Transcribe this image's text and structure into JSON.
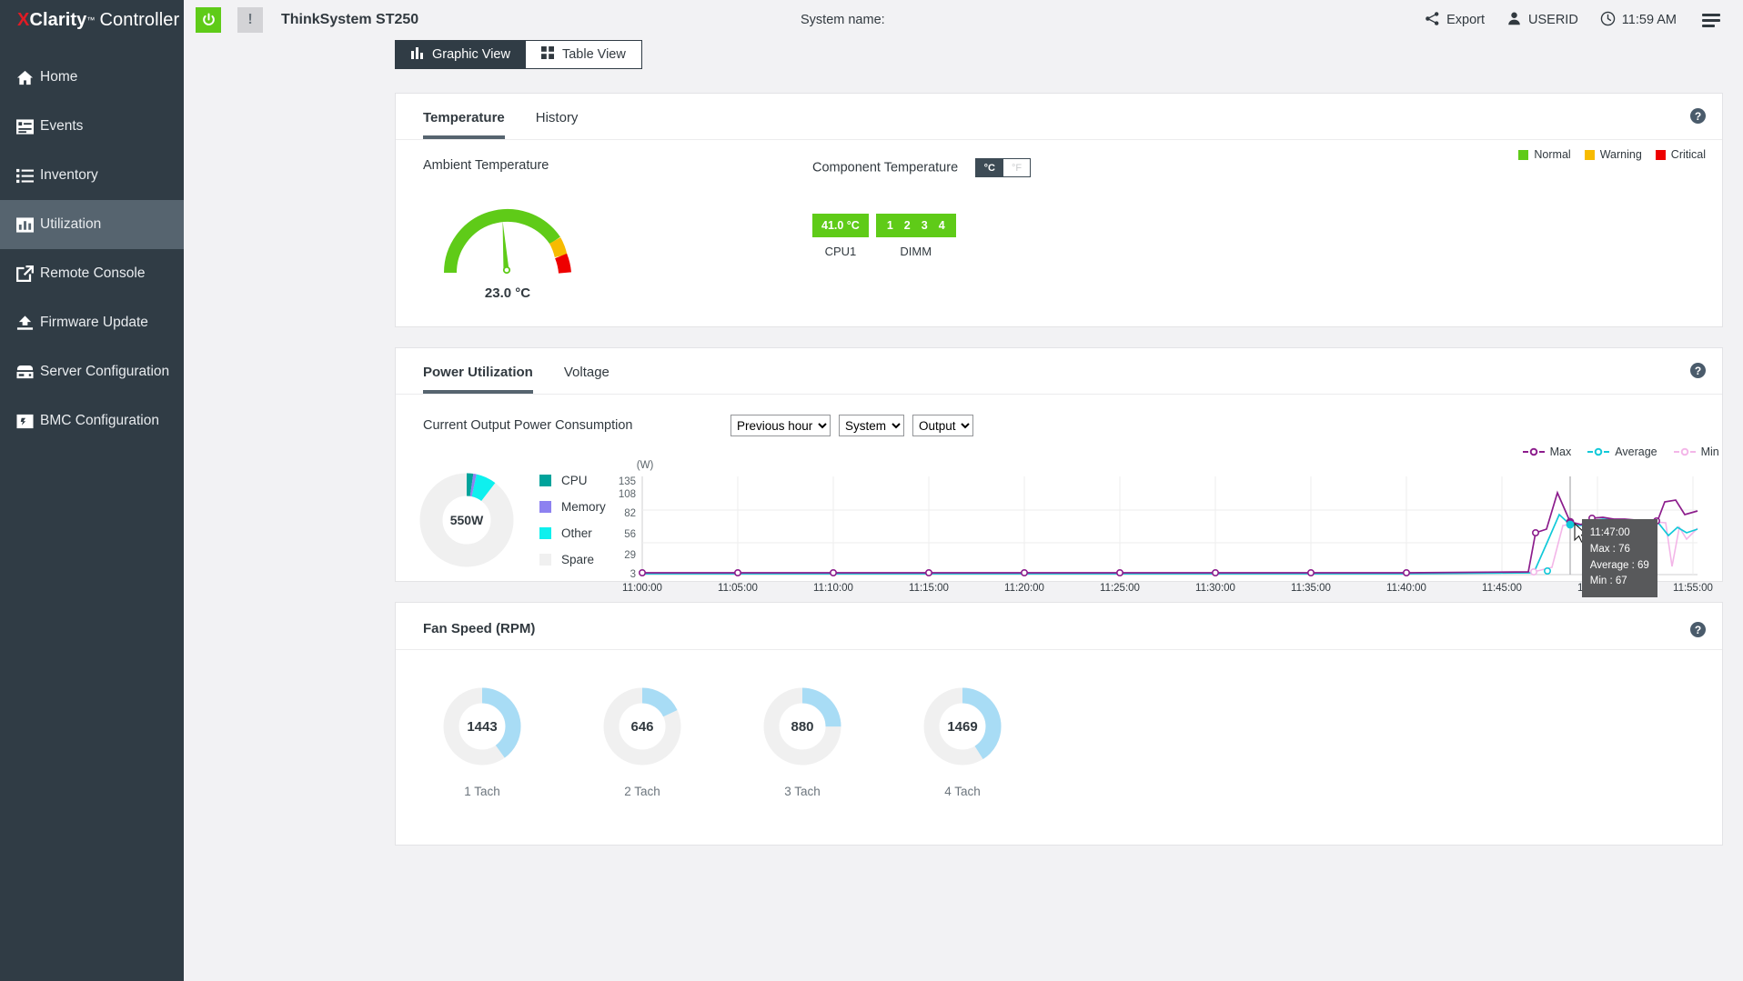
{
  "brand": {
    "x": "X",
    "clarity": "Clarity",
    "tm": "™",
    "controller": "Controller"
  },
  "sidebar": {
    "items": [
      {
        "label": "Home",
        "icon": "home-icon",
        "active": false
      },
      {
        "label": "Events",
        "icon": "events-icon",
        "active": false
      },
      {
        "label": "Inventory",
        "icon": "inventory-icon",
        "active": false
      },
      {
        "label": "Utilization",
        "icon": "utilization-icon",
        "active": true
      },
      {
        "label": "Remote Console",
        "icon": "remote-console-icon",
        "active": false
      },
      {
        "label": "Firmware Update",
        "icon": "firmware-update-icon",
        "active": false
      },
      {
        "label": "Server Configuration",
        "icon": "server-configuration-icon",
        "active": false
      },
      {
        "label": "BMC Configuration",
        "icon": "bmc-configuration-icon",
        "active": false
      }
    ]
  },
  "topbar": {
    "power_icon": "power-icon",
    "status_icon": "warning-icon",
    "status_symbol": "!",
    "model": "ThinkSystem ST250",
    "system_name_label": "System name:",
    "system_name_value": "",
    "export_label": "Export",
    "export_icon": "share-icon",
    "user_label": "USERID",
    "user_icon": "user-icon",
    "time_label": "11:59 AM",
    "time_icon": "clock-icon",
    "menu_icon": "hamburger-icon"
  },
  "view_switch": {
    "graphic": "Graphic View",
    "graphic_icon": "bar-chart-icon",
    "table": "Table View",
    "table_icon": "grid-icon",
    "selected": "Graphic View"
  },
  "temperature_card": {
    "tabs": [
      {
        "label": "Temperature",
        "active": true
      },
      {
        "label": "History",
        "active": false
      }
    ],
    "help_icon": "help-icon",
    "help_symbol": "?",
    "ambient": {
      "title": "Ambient Temperature",
      "value": "23.0 °C"
    },
    "component": {
      "title": "Component Temperature",
      "unit_celsius": "°C",
      "unit_fahrenheit": "°F",
      "selected_unit": "°C",
      "items": [
        {
          "badge": "41.0 °C",
          "label": "CPU1",
          "state": "Normal"
        },
        {
          "badge": "1 2 3 4",
          "label": "DIMM",
          "state": "Normal",
          "slots": [
            "1",
            "2",
            "3",
            "4"
          ]
        }
      ]
    },
    "legend": [
      {
        "label": "Normal",
        "color": "#5fcb18"
      },
      {
        "label": "Warning",
        "color": "#f7bb00"
      },
      {
        "label": "Critical",
        "color": "#ee0000"
      }
    ],
    "gauge": {
      "min_pct": 0,
      "value_pct": 47,
      "green_end_pct": 80,
      "warn_end_pct": 89
    }
  },
  "power_card": {
    "tabs": [
      {
        "label": "Power Utilization",
        "active": true
      },
      {
        "label": "Voltage",
        "active": false
      }
    ],
    "help_icon": "help-icon",
    "help_symbol": "?",
    "title": "Current Output Power Consumption",
    "selects": [
      {
        "name": "range-select",
        "value": "Previous hour",
        "options": [
          "Previous hour"
        ]
      },
      {
        "name": "scope-select",
        "value": "System",
        "options": [
          "System"
        ]
      },
      {
        "name": "type-select",
        "value": "Output",
        "options": [
          "Output"
        ]
      }
    ],
    "donut": {
      "center_label": "550W",
      "legend": [
        {
          "label": "CPU",
          "color": "#00a39b",
          "pct": 2.3
        },
        {
          "label": "Memory",
          "color": "#8d81f0",
          "pct": 1.1
        },
        {
          "label": "Other",
          "color": "#0ef0ee",
          "pct": 7.0
        },
        {
          "label": "Spare",
          "color": "#f0f0f0",
          "pct": 89.6
        }
      ]
    },
    "tooltip": {
      "time": "11:47:00",
      "max": "Max : 76",
      "average": "Average : 69",
      "min": "Min : 67"
    },
    "chart_data": {
      "type": "line",
      "title": "Current Output Power Consumption",
      "unit": "(W)",
      "ylabel": "(W)",
      "xlabel": "",
      "yticks": [
        3,
        29,
        56,
        82,
        108,
        135
      ],
      "ylim": [
        0,
        142
      ],
      "grid": true,
      "legend_position": "top-right",
      "xticks": [
        "11:00:00",
        "11:05:00",
        "11:10:00",
        "11:15:00",
        "11:20:00",
        "11:25:00",
        "11:30:00",
        "11:35:00",
        "11:40:00",
        "11:45:00",
        "11:50:00",
        "11:55:00"
      ],
      "x": [
        "11:00:00",
        "11:05:00",
        "11:10:00",
        "11:15:00",
        "11:20:00",
        "11:25:00",
        "11:30:00",
        "11:35:00",
        "11:40:00",
        "11:44:00",
        "11:45:00",
        "11:46:00",
        "11:47:00",
        "11:48:00",
        "11:49:00",
        "11:50:00",
        "11:51:00",
        "11:52:00",
        "11:53:00",
        "11:54:00",
        "11:55:00",
        "11:56:00",
        "11:57:00",
        "11:58:00",
        "11:59:00"
      ],
      "series": [
        {
          "name": "Max",
          "color": "#8c1d8c",
          "values": [
            3,
            3,
            3,
            3,
            3,
            3,
            3,
            3,
            3,
            58,
            66,
            118,
            76,
            72,
            80,
            81,
            79,
            78,
            77,
            77,
            76,
            110,
            112,
            92,
            97
          ]
        },
        {
          "name": "Average",
          "color": "#12c9d9",
          "values": [
            3,
            3,
            3,
            3,
            3,
            3,
            3,
            3,
            3,
            6,
            46,
            83,
            69,
            68,
            74,
            76,
            75,
            75,
            74,
            74,
            73,
            56,
            66,
            58,
            64
          ]
        },
        {
          "name": "Min",
          "color": "#f3b6e8",
          "values": [
            3,
            3,
            3,
            3,
            3,
            3,
            3,
            3,
            3,
            4,
            10,
            66,
            67,
            66,
            72,
            74,
            73,
            73,
            72,
            72,
            71,
            12,
            58,
            44,
            60
          ]
        }
      ]
    }
  },
  "fan_card": {
    "title": "Fan Speed (RPM)",
    "help_icon": "help-icon",
    "help_symbol": "?",
    "color": "#a8dcf5",
    "fans": [
      {
        "value": "1443",
        "label": "1 Tach",
        "pct": 40
      },
      {
        "value": "646",
        "label": "2 Tach",
        "pct": 18
      },
      {
        "value": "880",
        "label": "3 Tach",
        "pct": 25
      },
      {
        "value": "1469",
        "label": "4 Tach",
        "pct": 41
      }
    ]
  }
}
